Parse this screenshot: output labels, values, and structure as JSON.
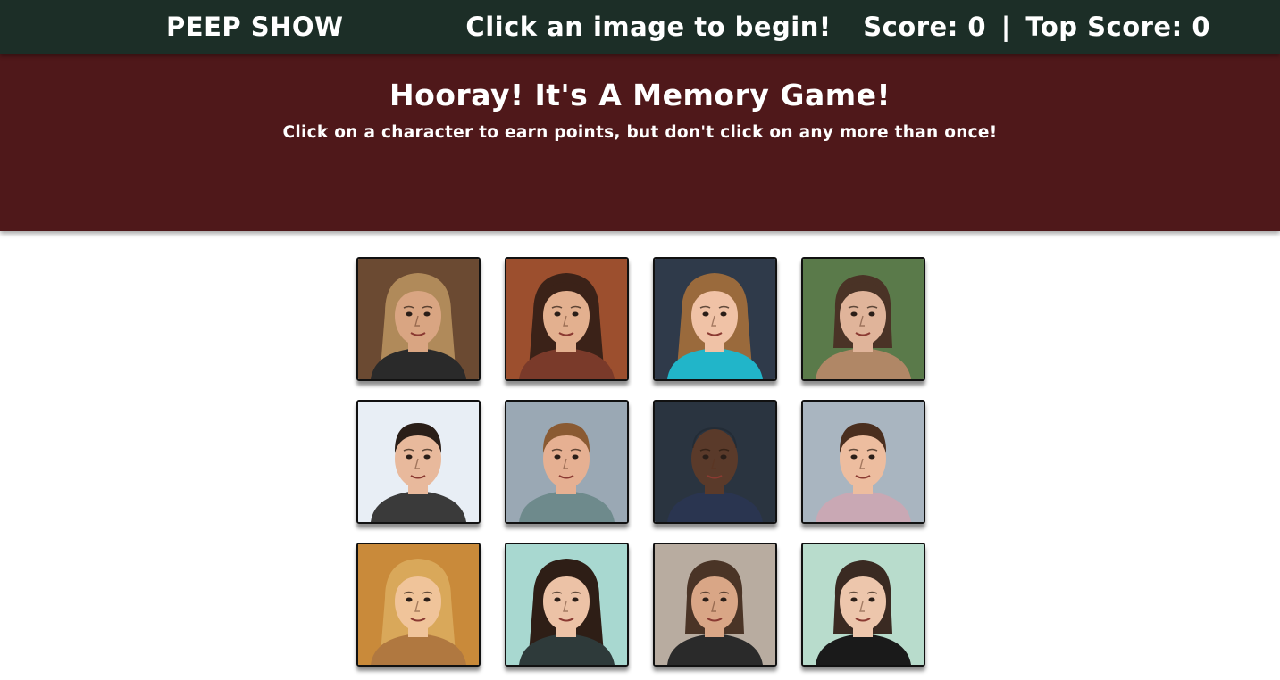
{
  "navbar": {
    "brand": "PEEP SHOW",
    "message": "Click an image to begin!",
    "score_label": "Score:",
    "score": 0,
    "separator": "|",
    "top_score_label": "Top Score:",
    "top_score": 0
  },
  "header": {
    "title": "Hooray! It's A Memory Game!",
    "subtitle": "Click on a character to earn points, but don't click on any more than once!"
  },
  "colors": {
    "navbar_bg": "#1c2e27",
    "jumbotron_bg": "#4f181a",
    "card_border": "#111111"
  },
  "cards": [
    {
      "bg": "#6b4a32",
      "skin": "#d9a582",
      "hair": "#b08a5a",
      "shirt": "#2a2a2a",
      "hair_style": "long"
    },
    {
      "bg": "#9c4f2e",
      "skin": "#e3b08f",
      "hair": "#3b2218",
      "shirt": "#7a3a2a",
      "hair_style": "long"
    },
    {
      "bg": "#2f3a4a",
      "skin": "#f0c2a6",
      "hair": "#9a6a3c",
      "shirt": "#21b5c9",
      "hair_style": "long"
    },
    {
      "bg": "#5a7a4a",
      "skin": "#e0b49a",
      "hair": "#4a3326",
      "shirt": "#b08766",
      "hair_style": "medium"
    },
    {
      "bg": "#e8eef5",
      "skin": "#e8b99c",
      "hair": "#2a1e18",
      "shirt": "#3a3a3a",
      "hair_style": "short"
    },
    {
      "bg": "#9aa8b4",
      "skin": "#e6b092",
      "hair": "#8a5a32",
      "shirt": "#6e8a8c",
      "hair_style": "short"
    },
    {
      "bg": "#2a3440",
      "skin": "#5a3a2a",
      "hair": "#2e2018",
      "shirt": "#2a3550",
      "hair_style": "bald"
    },
    {
      "bg": "#a9b5c0",
      "skin": "#edbd9f",
      "hair": "#4a2e1e",
      "shirt": "#c9a8b4",
      "hair_style": "short"
    },
    {
      "bg": "#c98a3a",
      "skin": "#f0c49a",
      "hair": "#d9a85a",
      "shirt": "#b07840",
      "hair_style": "long"
    },
    {
      "bg": "#a8d8d0",
      "skin": "#ecc2a6",
      "hair": "#2e1e16",
      "shirt": "#2e3a3a",
      "hair_style": "long"
    },
    {
      "bg": "#b8aca0",
      "skin": "#d9a686",
      "hair": "#4a3426",
      "shirt": "#2a2a2a",
      "hair_style": "medium"
    },
    {
      "bg": "#b8dccc",
      "skin": "#edc6ac",
      "hair": "#3a2a22",
      "shirt": "#1a1a1a",
      "hair_style": "medium"
    }
  ]
}
